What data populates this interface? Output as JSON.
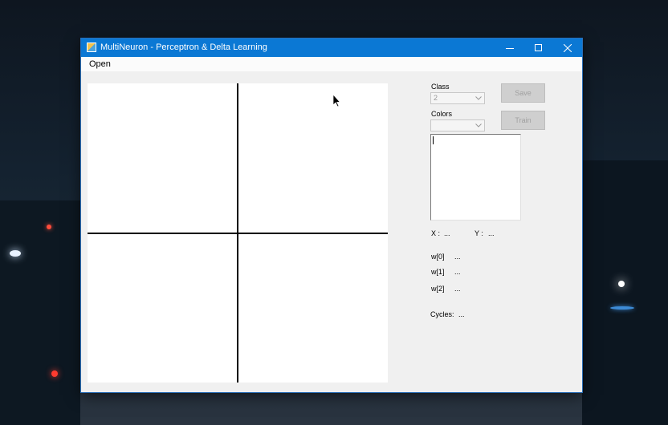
{
  "window": {
    "title": "MultiNeuron - Perceptron & Delta Learning",
    "controls": {
      "minimize": "—",
      "maximize": "☐",
      "close": "✕"
    }
  },
  "menu": {
    "items": [
      "Open"
    ]
  },
  "panel": {
    "class_label": "Class",
    "class_value": "2",
    "colors_label": "Colors",
    "colors_value": "",
    "save_label": "Save",
    "train_label": "Train",
    "x_label": "X :",
    "x_value": "...",
    "y_label": "Y :",
    "y_value": "...",
    "weights": [
      {
        "label": "w[0]",
        "value": "..."
      },
      {
        "label": "w[1]",
        "value": "..."
      },
      {
        "label": "w[2]",
        "value": "..."
      }
    ],
    "cycles_label": "Cycles:",
    "cycles_value": "..."
  },
  "icons": {
    "app": "app-icon",
    "cursor": "mouse-pointer-icon",
    "dropdown": "chevron-down-icon"
  },
  "colors": {
    "titlebar": "#0b78d4",
    "canvas": "#ffffff",
    "axes": "#000000",
    "window_bg": "#f0f0f0"
  }
}
